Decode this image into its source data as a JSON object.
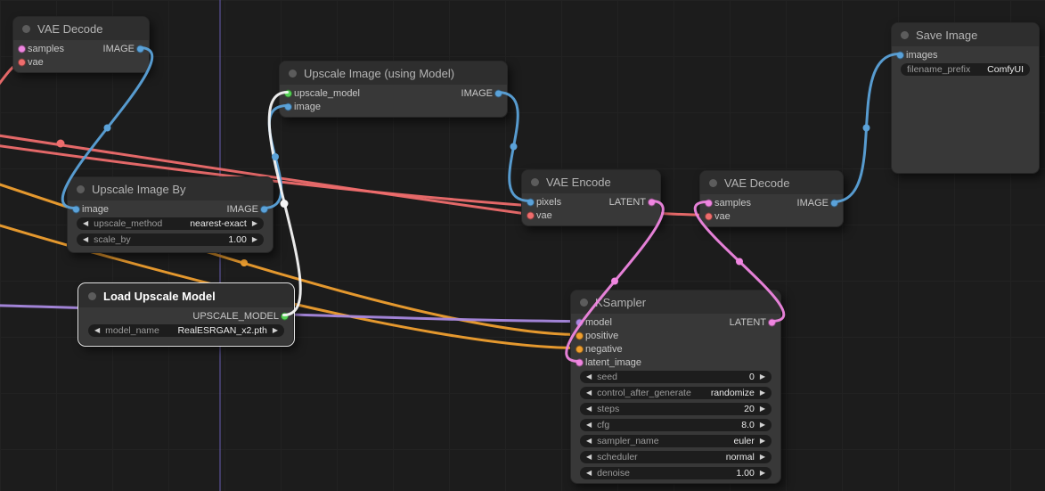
{
  "colors": {
    "image": "#5ba2d9",
    "vae": "#ee6d6d",
    "latent": "#ef86e0",
    "model": "#a989e0",
    "conditioning": "#ef9f2f",
    "upscale_model": "#57d457",
    "highlight": "#f5f5f5",
    "accent_line": "#6f63c0"
  },
  "nodes": {
    "vae_decode_1": {
      "title": "VAE Decode",
      "inputs": [
        {
          "label": "samples"
        },
        {
          "label": "vae"
        }
      ],
      "outputs": [
        {
          "label": "IMAGE"
        }
      ]
    },
    "upscale_model_node": {
      "title": "Upscale Image (using Model)",
      "inputs": [
        {
          "label": "upscale_model"
        },
        {
          "label": "image"
        }
      ],
      "outputs": [
        {
          "label": "IMAGE"
        }
      ]
    },
    "save_image": {
      "title": "Save Image",
      "inputs": [
        {
          "label": "images"
        }
      ],
      "widgets": [
        {
          "label": "filename_prefix",
          "value": "ComfyUI"
        }
      ]
    },
    "upscale_by": {
      "title": "Upscale Image By",
      "inputs": [
        {
          "label": "image"
        }
      ],
      "outputs": [
        {
          "label": "IMAGE"
        }
      ],
      "widgets": [
        {
          "label": "upscale_method",
          "value": "nearest-exact"
        },
        {
          "label": "scale_by",
          "value": "1.00"
        }
      ]
    },
    "vae_encode": {
      "title": "VAE Encode",
      "inputs": [
        {
          "label": "pixels"
        },
        {
          "label": "vae"
        }
      ],
      "outputs": [
        {
          "label": "LATENT"
        }
      ]
    },
    "vae_decode_2": {
      "title": "VAE Decode",
      "inputs": [
        {
          "label": "samples"
        },
        {
          "label": "vae"
        }
      ],
      "outputs": [
        {
          "label": "IMAGE"
        }
      ]
    },
    "load_upscale": {
      "title": "Load Upscale Model",
      "selected": true,
      "outputs": [
        {
          "label": "UPSCALE_MODEL"
        }
      ],
      "widgets": [
        {
          "label": "model_name",
          "value": "RealESRGAN_x2.pth"
        }
      ]
    },
    "ksampler": {
      "title": "KSampler",
      "inputs": [
        {
          "label": "model"
        },
        {
          "label": "positive"
        },
        {
          "label": "negative"
        },
        {
          "label": "latent_image"
        }
      ],
      "outputs": [
        {
          "label": "LATENT"
        }
      ],
      "widgets": [
        {
          "label": "seed",
          "value": "0"
        },
        {
          "label": "control_after_generate",
          "value": "randomize"
        },
        {
          "label": "steps",
          "value": "20"
        },
        {
          "label": "cfg",
          "value": "8.0"
        },
        {
          "label": "sampler_name",
          "value": "euler"
        },
        {
          "label": "scheduler",
          "value": "normal"
        },
        {
          "label": "denoise",
          "value": "1.00"
        }
      ]
    }
  },
  "links": [
    {
      "from": "VAE Decode.IMAGE",
      "to": "Upscale Image By.image",
      "type": "image"
    },
    {
      "from": "Upscale Image By.IMAGE",
      "to": "Upscale Image (using Model).image",
      "type": "image"
    },
    {
      "from": "Load Upscale Model.UPSCALE_MODEL",
      "to": "Upscale Image (using Model).upscale_model",
      "type": "upscale_model",
      "highlighted": true
    },
    {
      "from": "Upscale Image (using Model).IMAGE",
      "to": "VAE Encode.pixels",
      "type": "image"
    },
    {
      "from": "VAE Encode.LATENT",
      "to": "KSampler.latent_image",
      "type": "latent"
    },
    {
      "from": "KSampler.LATENT",
      "to": "VAE Decode.samples",
      "type": "latent"
    },
    {
      "from": "VAE Decode.IMAGE",
      "to": "Save Image.images",
      "type": "image"
    },
    {
      "from": "offscreen.VAE",
      "to": "VAE Encode.vae",
      "type": "vae"
    },
    {
      "from": "offscreen.VAE",
      "to": "VAE Decode.vae",
      "type": "vae"
    },
    {
      "from": "offscreen.VAE",
      "to": "VAE Decode (top-left).vae",
      "type": "vae"
    },
    {
      "from": "offscreen.CONDITIONING",
      "to": "KSampler.positive",
      "type": "conditioning"
    },
    {
      "from": "offscreen.CONDITIONING",
      "to": "KSampler.negative",
      "type": "conditioning"
    },
    {
      "from": "offscreen.MODEL",
      "to": "KSampler.model",
      "type": "model"
    }
  ]
}
